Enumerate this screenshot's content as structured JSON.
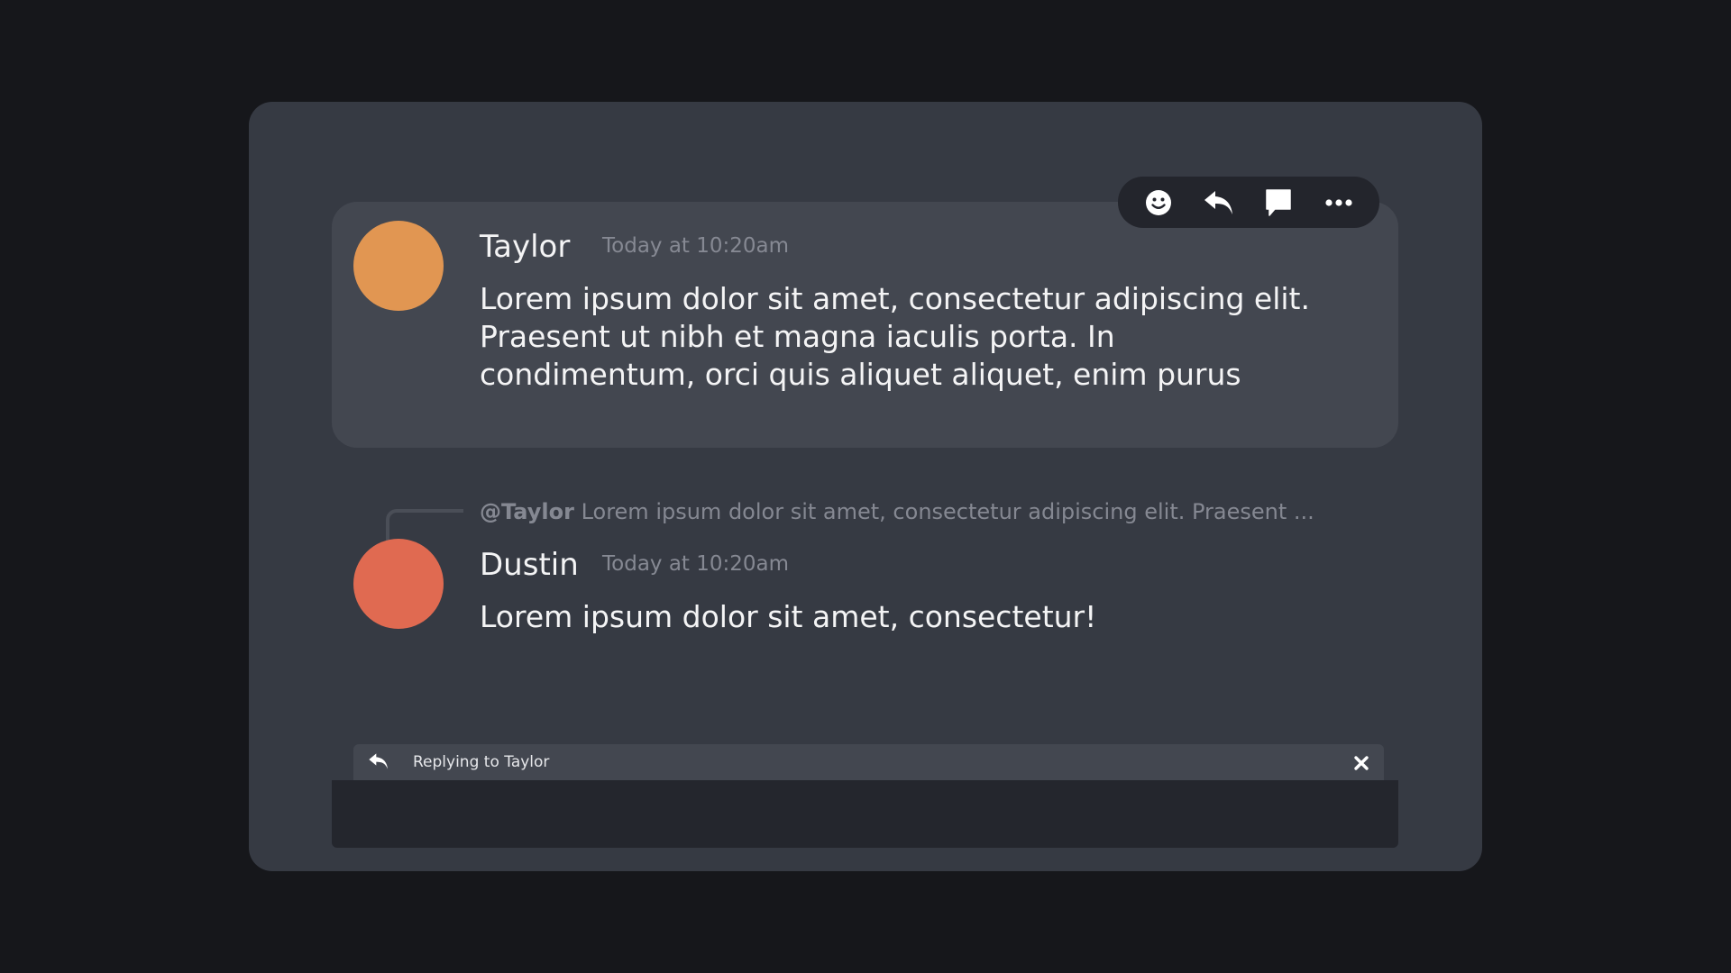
{
  "colors": {
    "background": "#16171b",
    "panel": "#363a43",
    "highlight": "#434750",
    "avatar_taylor": "#e19652",
    "avatar_dustin": "#e06a51",
    "toolbar": "#23252c",
    "composer": "#24262d"
  },
  "toolbar": {
    "icons": [
      "emoji-icon",
      "reply-icon",
      "comment-icon",
      "more-icon"
    ]
  },
  "messages": [
    {
      "author": "Taylor",
      "timestamp": "Today at 10:20am",
      "lines": [
        "Lorem ipsum dolor sit amet, consectetur adipiscing elit.",
        "Praesent ut nibh et magna iaculis porta. In",
        "condimentum, orci quis aliquet aliquet, enim purus"
      ]
    },
    {
      "reply_to": {
        "mention": "@Taylor",
        "excerpt": " Lorem ipsum dolor sit amet, consectetur adipiscing elit. Praesent ..."
      },
      "author": "Dustin",
      "timestamp": "Today at 10:20am",
      "lines": [
        "Lorem ipsum dolor sit amet, consectetur!"
      ]
    }
  ],
  "reply_bar": {
    "label": "Replying to Taylor"
  },
  "composer": {
    "value": "",
    "placeholder": ""
  }
}
